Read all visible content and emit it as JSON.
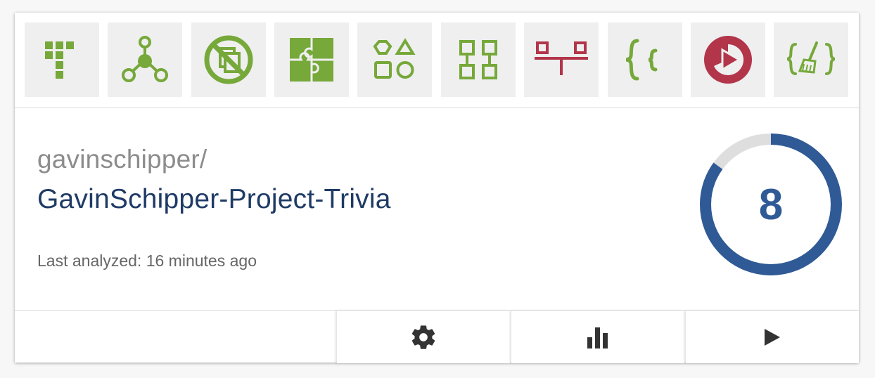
{
  "repo": {
    "owner": "gavinschipper/",
    "name": "GavinSchipper-Project-Trivia",
    "last_analyzed": "Last analyzed: 16 minutes ago"
  },
  "score": {
    "value": "8",
    "fraction": 0.85,
    "color": "#2f5a96",
    "track_color": "#dedede"
  },
  "icons": [
    {
      "name": "dependency-tree-icon",
      "color": "#76a83a"
    },
    {
      "name": "network-graph-icon",
      "color": "#76a83a"
    },
    {
      "name": "no-duplicate-icon",
      "color": "#76a83a"
    },
    {
      "name": "puzzle-icon",
      "color": "#76a83a"
    },
    {
      "name": "shapes-icon",
      "color": "#76a83a"
    },
    {
      "name": "modules-icon",
      "color": "#76a83a"
    },
    {
      "name": "balance-icon",
      "color": "#b2354a"
    },
    {
      "name": "braces-icon",
      "color": "#76a83a"
    },
    {
      "name": "play-coverage-icon",
      "color": "#b2354a"
    },
    {
      "name": "code-cleanup-icon",
      "color": "#76a83a"
    }
  ],
  "actions": [
    {
      "name": "settings-button",
      "icon": "gear-icon"
    },
    {
      "name": "stats-button",
      "icon": "bar-chart-icon"
    },
    {
      "name": "run-button",
      "icon": "play-icon"
    }
  ]
}
